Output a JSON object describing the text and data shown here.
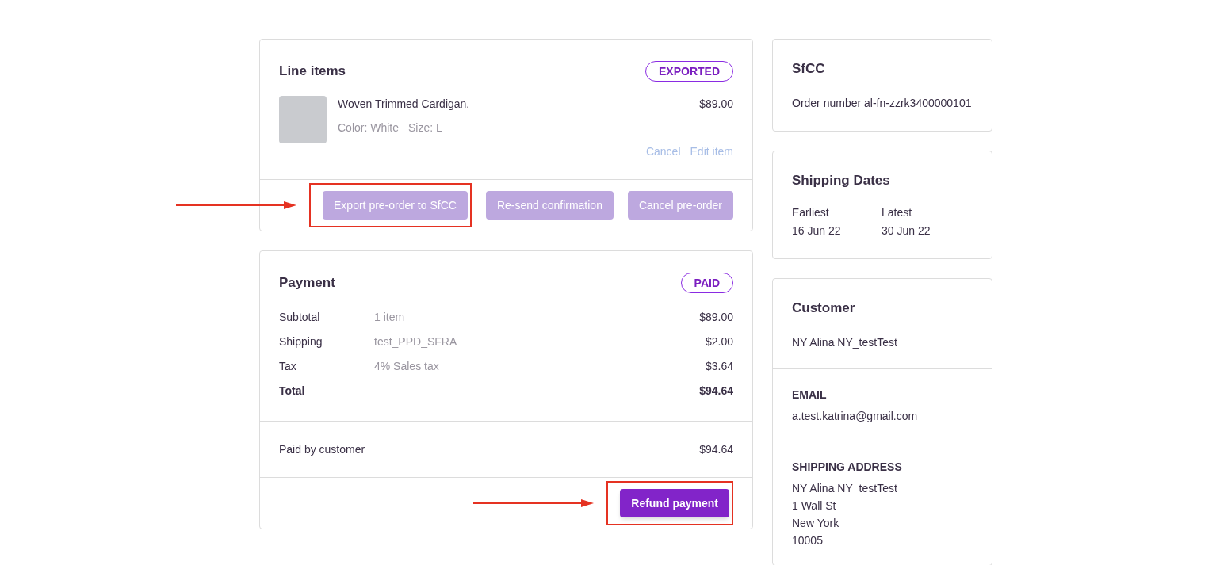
{
  "line_items": {
    "title": "Line items",
    "badge": "EXPORTED",
    "items": [
      {
        "name": "Woven Trimmed Cardigan.",
        "attributes": [
          "Color: White",
          "Size: L"
        ],
        "price": "$89.00",
        "links": [
          "Cancel",
          "Edit item"
        ]
      }
    ],
    "buttons": [
      {
        "label": "Export pre-order to SfCC",
        "disabled": true,
        "highlighted": true
      },
      {
        "label": "Re-send confirmation",
        "disabled": true,
        "highlighted": false
      },
      {
        "label": "Cancel pre-order",
        "disabled": true,
        "highlighted": false
      }
    ]
  },
  "payment": {
    "title": "Payment",
    "badge": "PAID",
    "rows": [
      {
        "label": "Subtotal",
        "detail": "1 item",
        "amount": "$89.00",
        "bold": false
      },
      {
        "label": "Shipping",
        "detail": "test_PPD_SFRA",
        "amount": "$2.00",
        "bold": false
      },
      {
        "label": "Tax",
        "detail": "4% Sales tax",
        "amount": "$3.64",
        "bold": false
      },
      {
        "label": "Total",
        "amount": "$94.64",
        "bold": true
      }
    ],
    "paid": {
      "label": "Paid by customer",
      "amount": "$94.64"
    },
    "buttons": [
      {
        "label": "Refund payment",
        "disabled": false,
        "highlighted": true
      }
    ]
  },
  "sfcc": {
    "title": "SfCC",
    "order_number": "Order number al-fn-zzrk3400000101"
  },
  "shipping_dates": {
    "title": "Shipping Dates",
    "dates": [
      {
        "label": "Earliest",
        "value": "16 Jun 22"
      },
      {
        "label": "Latest",
        "value": "30 Jun 22"
      }
    ]
  },
  "customer": {
    "title": "Customer",
    "name": "NY Alina NY_testTest",
    "sections": [
      {
        "heading": "EMAIL",
        "lines": [
          "a.test.katrina@gmail.com"
        ]
      },
      {
        "heading": "SHIPPING ADDRESS",
        "lines": [
          "NY Alina NY_testTest",
          "1 Wall St",
          "New York",
          "10005"
        ]
      }
    ]
  }
}
